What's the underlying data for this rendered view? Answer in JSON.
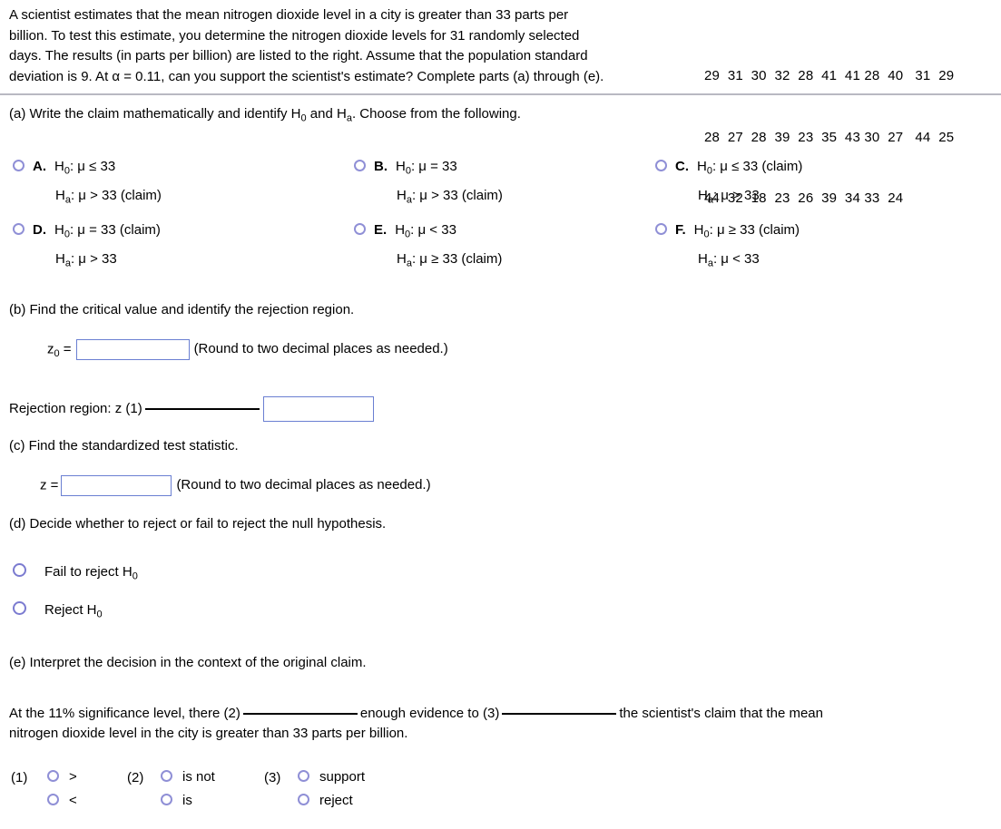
{
  "problem": {
    "stem_lines": [
      "A scientist estimates that the mean nitrogen dioxide level in a city is greater than 33 parts per",
      "billion. To test this estimate, you determine the nitrogen dioxide levels for 31 randomly selected",
      "days. The results (in parts per billion) are listed to the right. Assume that the population standard",
      "deviation is 9. At α = 0.11, can you support the scientist's estimate? Complete parts (a) through (e)."
    ],
    "data_rows": [
      "29  31  30  32  28  41  41 28  40   31  29",
      "28  27  28  39  23  35  43 30  27   44  25",
      "44  32  18  23  26  39  34 33  24"
    ],
    "sample_size": 31,
    "population_sd": 9,
    "alpha": "0.11",
    "claim_value": 33
  },
  "part_a": {
    "prompt_pre": "(a) Write the claim mathematically and identify H",
    "prompt_sub1": "0",
    "prompt_mid": " and H",
    "prompt_sub2": "a",
    "prompt_post": ". Choose from the following.",
    "options": [
      {
        "letter": "A.",
        "null_label": "H",
        "null_sub": "0",
        "null_text": ": μ ≤ 33",
        "alt_label": "H",
        "alt_sub": "a",
        "alt_text": ": μ > 33 (claim)"
      },
      {
        "letter": "B.",
        "null_label": "H",
        "null_sub": "0",
        "null_text": ": μ = 33",
        "alt_label": "H",
        "alt_sub": "a",
        "alt_text": ": μ > 33 (claim)"
      },
      {
        "letter": "C.",
        "null_label": "H",
        "null_sub": "0",
        "null_text": ": μ ≤ 33 (claim)",
        "alt_label": "H",
        "alt_sub": "a",
        "alt_text": ": μ > 33"
      },
      {
        "letter": "D.",
        "null_label": "H",
        "null_sub": "0",
        "null_text": ": μ = 33 (claim)",
        "alt_label": "H",
        "alt_sub": "a",
        "alt_text": ": μ > 33"
      },
      {
        "letter": "E.",
        "null_label": "H",
        "null_sub": "0",
        "null_text": ": μ < 33",
        "alt_label": "H",
        "alt_sub": "a",
        "alt_text": ": μ ≥ 33 (claim)"
      },
      {
        "letter": "F.",
        "null_label": "H",
        "null_sub": "0",
        "null_text": ": μ ≥ 33 (claim)",
        "alt_label": "H",
        "alt_sub": "a",
        "alt_text": ": μ < 33"
      }
    ]
  },
  "part_b": {
    "prompt": "(b) Find the critical value and identify the rejection region.",
    "z0_label": "z",
    "z0_sub": "0",
    "z0_eq": " =",
    "z0_value": "",
    "round_note": "(Round to two decimal places as needed.)",
    "rejection_label": "Rejection region: z (1)",
    "rejection_value": ""
  },
  "part_c": {
    "prompt": "(c) Find the standardized test statistic.",
    "z_label": "z =",
    "z_value": "",
    "round_note": "(Round to two decimal places as needed.)"
  },
  "part_d": {
    "prompt": "(d) Decide whether to reject or fail to reject the null hypothesis.",
    "choices": [
      {
        "text_pre": "Fail to reject H",
        "text_sub": "0"
      },
      {
        "text_pre": "Reject H",
        "text_sub": "0"
      }
    ]
  },
  "part_e": {
    "prompt": "(e) Interpret the decision in the context of the original claim.",
    "sentence_a": "At the 11% significance level, there",
    "tag_2": "(2)",
    "sentence_b": "enough evidence to",
    "tag_3": "(3)",
    "sentence_c": "the scientist's claim that the mean",
    "sentence_d": "nitrogen dioxide level in the city is greater than 33 parts per billion."
  },
  "legends": [
    {
      "tag": "(1)",
      "options": [
        ">",
        "<"
      ]
    },
    {
      "tag": "(2)",
      "options": [
        "is not",
        "is"
      ]
    },
    {
      "tag": "(3)",
      "options": [
        "support",
        "reject"
      ]
    }
  ],
  "colors": {
    "radio_border": "#8f8fd6",
    "input_border": "#6a7fd2",
    "divider": "#b9b9c2",
    "text": "#000000"
  }
}
